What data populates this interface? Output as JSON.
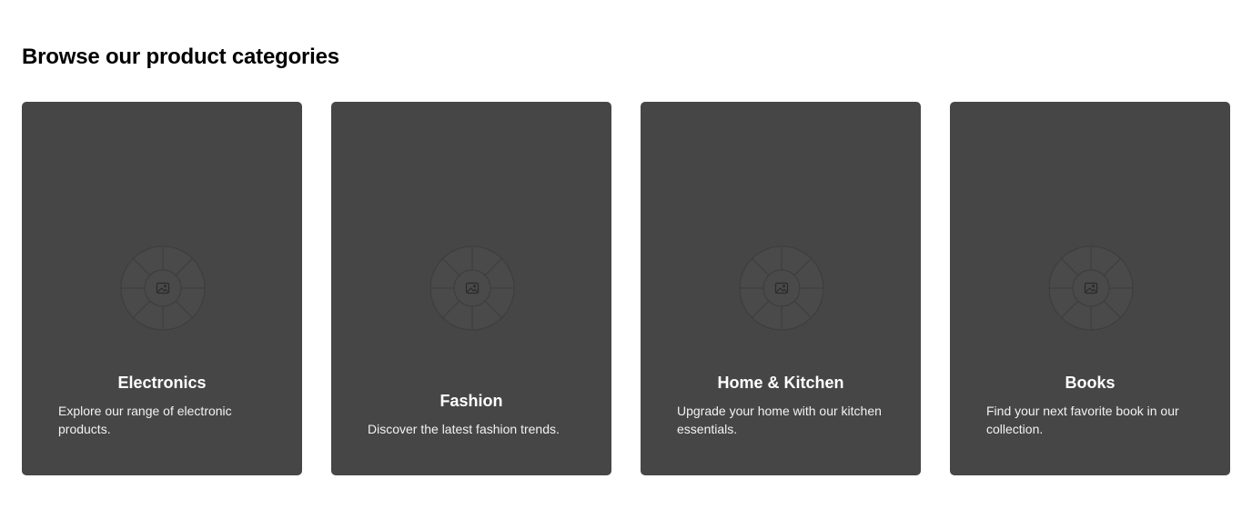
{
  "section": {
    "heading": "Browse our product categories"
  },
  "categories": [
    {
      "title": "Electronics",
      "description": "Explore our range of electronic products.",
      "icon": "image-placeholder-icon"
    },
    {
      "title": "Fashion",
      "description": "Discover the latest fashion trends.",
      "icon": "image-placeholder-icon"
    },
    {
      "title": "Home & Kitchen",
      "description": "Upgrade your home with our kitchen essentials.",
      "icon": "image-placeholder-icon"
    },
    {
      "title": "Books",
      "description": "Find your next favorite book in our collection.",
      "icon": "image-placeholder-icon"
    }
  ],
  "colors": {
    "card_background": "#464646",
    "heading_text": "#000000",
    "card_text": "#ffffff"
  }
}
